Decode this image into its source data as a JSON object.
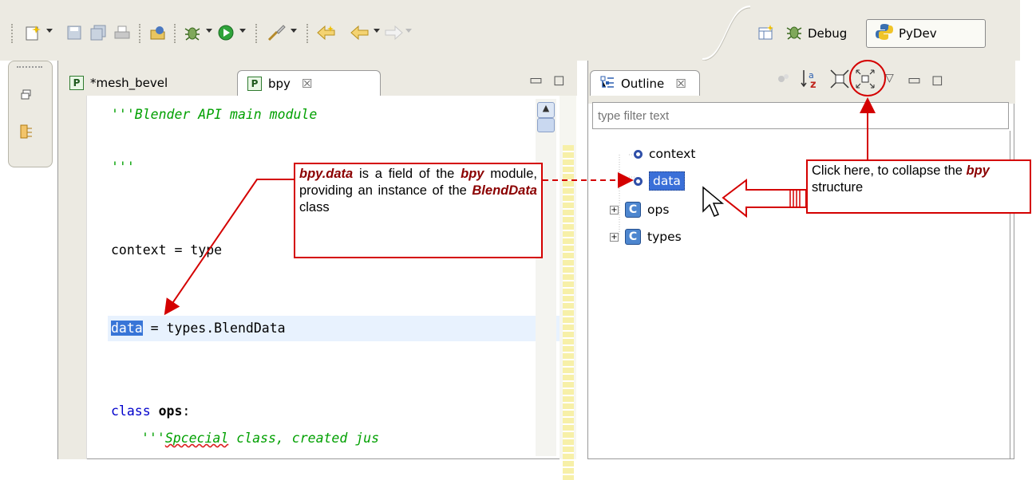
{
  "toolbar": {
    "icons": [
      "new-file-icon",
      "save-icon",
      "save-all-icon",
      "print-icon",
      "open-perspective-icon",
      "debug-icon",
      "run-icon",
      "external-tools-icon",
      "prev-annotation-icon",
      "back-icon",
      "forward-icon"
    ],
    "perspectives": [
      {
        "label": "Debug",
        "icon": "bug-icon"
      },
      {
        "label": "PyDev",
        "icon": "python-icon"
      }
    ]
  },
  "editor": {
    "tabs": [
      {
        "label": "*mesh_bevel",
        "icon": "P"
      },
      {
        "label": "bpy",
        "icon": "P"
      }
    ],
    "close_glyph": "☒",
    "code": {
      "line1": "'''Blender API main module",
      "line2": "'''",
      "line3": "context = type",
      "line4_sel": "data",
      "line4_rest": " = types.BlendData",
      "line5_kw": "class ",
      "line5_name": "ops",
      "line5_end": ":",
      "line6_a": "'''",
      "line6_b": "Spcecial",
      "line6_c": " class, created jus"
    }
  },
  "outline": {
    "tab_label": "Outline",
    "close_glyph": "☒",
    "filter_placeholder": "type filter text",
    "tree": [
      {
        "label": "context",
        "kind": "field",
        "selected": false
      },
      {
        "label": "data",
        "kind": "field",
        "selected": true
      },
      {
        "label": "ops",
        "kind": "class",
        "selected": false
      },
      {
        "label": "types",
        "kind": "class",
        "selected": false
      }
    ],
    "class_letter": "C",
    "sort_icon_text": "a z"
  },
  "annotations": {
    "callout1": {
      "t1": "bpy.data",
      "t2": " is a field of the ",
      "t3": "bpy",
      "t4": " module, providing an instance of the ",
      "t5": "BlendData",
      "t6": " class"
    },
    "callout2": {
      "t1": "Click here, to collapse the ",
      "t2": "bpy",
      "t3": " structure"
    },
    "accent_color": "#d40000"
  }
}
